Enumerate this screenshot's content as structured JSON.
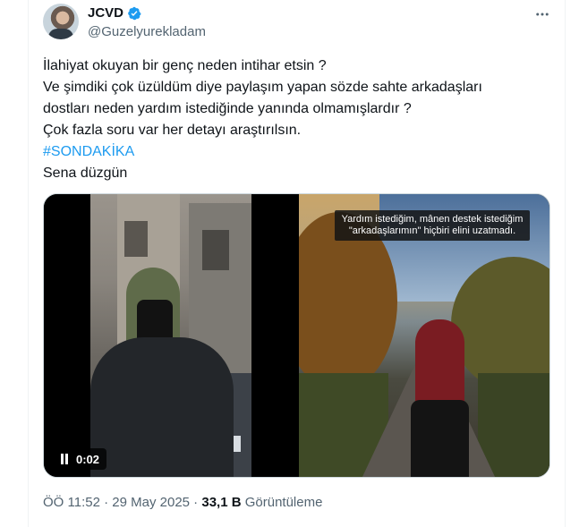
{
  "author": {
    "display_name": "JCVD",
    "handle": "@Guzelyurekladam",
    "verified_color": "#1d9bf0"
  },
  "tweet": {
    "lines": [
      "İlahiyat okuyan bir genç neden intihar etsin ?",
      "Ve şimdiki çok üzüldüm diye paylaşım yapan sözde sahte arkadaşları",
      "dostları neden yardım istediğinde yanında olmamışlardır ?",
      "Çok fazla soru var her detayı araştırılsın."
    ],
    "hashtag": "#SONDAKİKA",
    "last_line": "Sena düzgün"
  },
  "media": {
    "video_time": "0:02",
    "photo_caption": "Yardım istediğim, mânen destek istediğim \"arkadaşlarımın\" hiçbiri elini uzatmadı."
  },
  "meta": {
    "time": "ÖÖ 11:52",
    "sep1": " · ",
    "date": "29 May 2025",
    "sep2": " · ",
    "views": "33,1 B",
    "views_label": " Görüntüleme"
  },
  "colors": {
    "link": "#1d9bf0",
    "secondary_text": "#536471",
    "primary_text": "#0f1419"
  },
  "icons": [
    "verified-badge-icon",
    "more-icon",
    "pause-icon"
  ]
}
